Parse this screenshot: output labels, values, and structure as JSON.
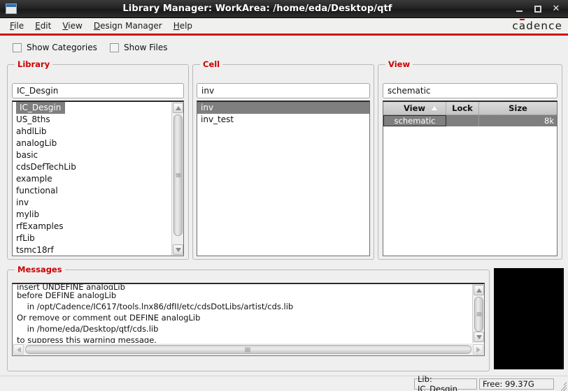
{
  "window": {
    "title": "Library Manager: WorkArea: /home/eda/Desktop/qtf",
    "icon": "window-icon",
    "minimize_label": "_",
    "maximize_label": "□",
    "close_label": "✕"
  },
  "menubar": {
    "items": [
      {
        "label": "File",
        "mnemonic": "F"
      },
      {
        "label": "Edit",
        "mnemonic": "E"
      },
      {
        "label": "View",
        "mnemonic": "V"
      },
      {
        "label": "Design Manager",
        "mnemonic": "D"
      },
      {
        "label": "Help",
        "mnemonic": "H"
      }
    ],
    "brand": "cadence",
    "brand_color": "#cc0000",
    "accent_rule_color": "#d10a11"
  },
  "options": {
    "checkboxes": [
      {
        "label": "Show Categories",
        "checked": false
      },
      {
        "label": "Show Files",
        "checked": false
      }
    ]
  },
  "library_panel": {
    "title": "Library",
    "filter_value": "IC_Desgin",
    "items": [
      "IC_Desgin",
      "US_8ths",
      "ahdlLib",
      "analogLib",
      "basic",
      "cdsDefTechLib",
      "example",
      "functional",
      "inv",
      "mylib",
      "rfExamples",
      "rfLib",
      "tsmc18rf"
    ],
    "selected": "IC_Desgin"
  },
  "cell_panel": {
    "title": "Cell",
    "filter_value": "inv",
    "items": [
      "inv",
      "inv_test"
    ],
    "selected": "inv"
  },
  "view_panel": {
    "title": "View",
    "filter_value": "schematic",
    "columns": [
      "View",
      "Lock",
      "Size"
    ],
    "sort_column": "View",
    "sort_direction": "ascending",
    "rows": [
      {
        "view": "schematic",
        "lock": "",
        "size": "8k"
      }
    ],
    "selected": "schematic"
  },
  "messages_panel": {
    "title": "Messages",
    "lines": [
      "insert UNDEFINE analogLib",
      "before DEFINE analogLib",
      "    in /opt/Cadence/IC617/tools.lnx86/dfII/etc/cdsDotLibs/artist/cds.lib",
      "Or remove or comment out DEFINE analogLib",
      "    in /home/eda/Desktop/qtf/cds.lib",
      "to suppress this warning message."
    ]
  },
  "statusbar": {
    "library": "Lib: IC_Desgin",
    "free_space": "Free: 99.37G"
  },
  "colors": {
    "group_title": "#cc0000",
    "selection": "#7f7f7f",
    "titlebar": "#242424",
    "panel_bg": "#efefef"
  }
}
